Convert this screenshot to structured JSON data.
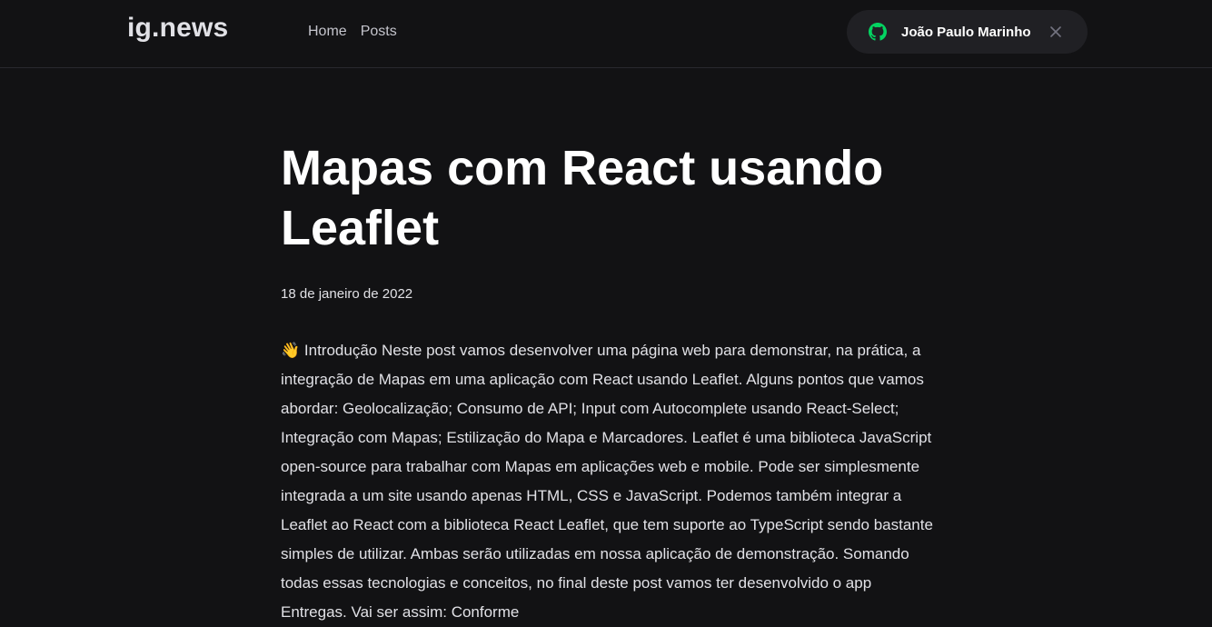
{
  "header": {
    "logo": "ig.news",
    "nav": [
      {
        "label": "Home"
      },
      {
        "label": "Posts"
      }
    ],
    "user": {
      "name": "João Paulo Marinho",
      "icon": "github-icon",
      "icon_color": "#04d361",
      "close_icon": "close-icon"
    }
  },
  "post": {
    "title": "Mapas com React usando Leaflet",
    "date": "18 de janeiro de 2022",
    "emoji": "👋",
    "content": "Introdução Neste post vamos desenvolver uma página web para demonstrar, na prática, a integração de Mapas em uma aplicação com React usando Leaflet. Alguns pontos que vamos abordar: Geolocalização; Consumo de API; Input com Autocomplete usando React-Select; Integração com Mapas; Estilização do Mapa e Marcadores. Leaflet é uma biblioteca JavaScript open-source para trabalhar com Mapas em aplicações web e mobile. Pode ser simplesmente integrada a um site usando apenas HTML, CSS e JavaScript. Podemos também integrar a Leaflet ao React com a biblioteca React Leaflet, que tem suporte ao TypeScript sendo bastante simples de utilizar. Ambas serão utilizadas em nossa aplicação de demonstração. Somando todas essas tecnologias e conceitos, no final deste post vamos ter desenvolvido o app Entregas. Vai ser assim: Conforme"
  }
}
